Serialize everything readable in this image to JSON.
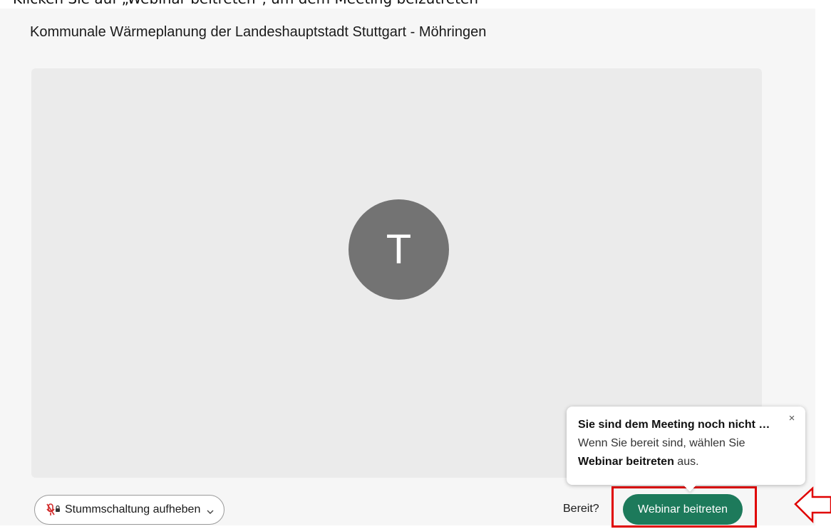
{
  "page": {
    "cut_caption": "Klicken Sie auf „Webinar beitreten“, um dem Meeting beizutreten"
  },
  "meeting": {
    "title": "Kommunale Wärmeplanung der Landeshauptstadt Stuttgart - Möhringen",
    "avatar_initial": "T"
  },
  "controls": {
    "unmute_label": "Stummschaltung aufheben",
    "ready_label": "Bereit?",
    "join_label": "Webinar beitreten"
  },
  "tooltip": {
    "title": "Sie sind dem Meeting noch nicht beigetreten",
    "line1": "Wenn Sie bereit sind, wählen Sie",
    "line2_bold": "Webinar beitreten",
    "line2_rest": " aus.",
    "close_symbol": "×"
  },
  "colors": {
    "join_button": "#1d7a5b",
    "highlight": "#e00000",
    "avatar": "#737373",
    "preview_bg": "#ebebeb"
  },
  "icons": {
    "unmute": "microphone-muted-icon",
    "dropdown": "chevron-down-icon",
    "close": "close-icon",
    "annotation": "arrow-left-icon"
  }
}
